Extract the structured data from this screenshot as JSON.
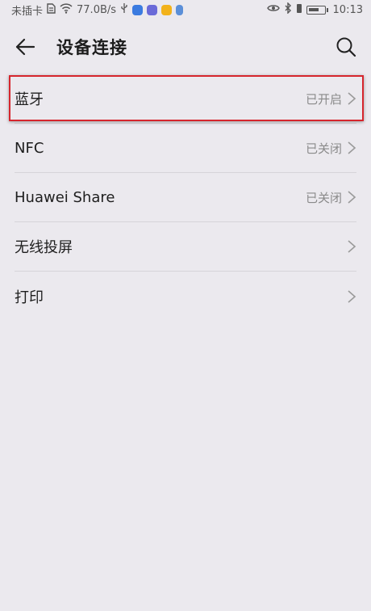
{
  "status_bar": {
    "carrier": "未插卡",
    "speed": "77.0B/s",
    "time": "10:13"
  },
  "header": {
    "title": "设备连接"
  },
  "items": [
    {
      "label": "蓝牙",
      "status": "已开启"
    },
    {
      "label": "NFC",
      "status": "已关闭"
    },
    {
      "label": "Huawei Share",
      "status": "已关闭"
    },
    {
      "label": "无线投屏",
      "status": ""
    },
    {
      "label": "打印",
      "status": ""
    }
  ],
  "colors": {
    "background": "#ebe9ee",
    "highlight": "#d6262d",
    "secondary_text": "#8a8a8a"
  }
}
